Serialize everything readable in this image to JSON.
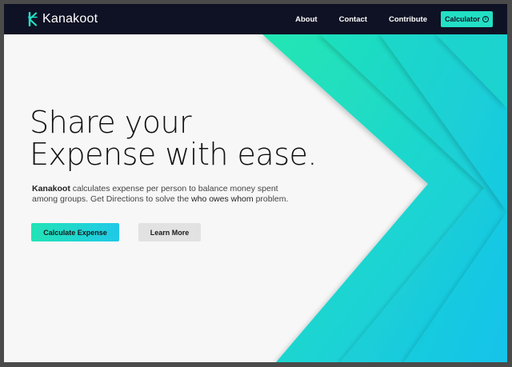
{
  "brand": {
    "name": "Kanakoot",
    "icon": "kanakoot-k-logo"
  },
  "nav": {
    "links": [
      "About",
      "Contact",
      "Contribute"
    ],
    "cta_label": "Calculator",
    "cta_icon": "info-icon"
  },
  "hero": {
    "headline_line1": "Share your",
    "headline_line2": "Expense with ease.",
    "desc_brand": "Kanakoot",
    "desc_part1": " calculates expense per person to balance money spent among groups. Get Directions to solve the ",
    "desc_highlight": "who owes whom",
    "desc_part2": " problem.",
    "primary_button": "Calculate Expense",
    "secondary_button": "Learn More"
  },
  "colors": {
    "navbar": "#0f1224",
    "accent_teal": "#22e0c4",
    "accent_cyan": "#1fc9e8",
    "page_bg": "#f7f7f7"
  }
}
